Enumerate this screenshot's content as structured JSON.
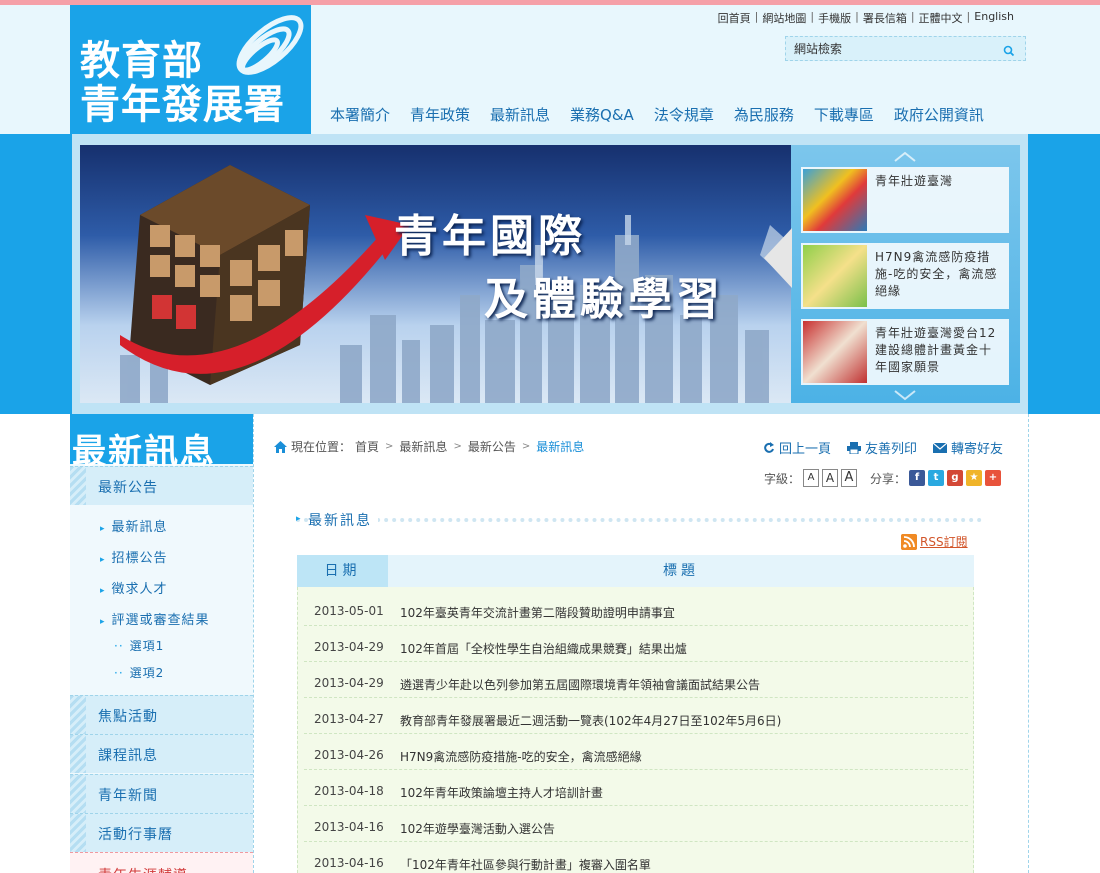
{
  "logo": {
    "line1": "教育部",
    "line2": "青年發展署"
  },
  "toplinks": [
    "回首頁",
    "網站地圖",
    "手機版",
    "署長信箱",
    "正體中文",
    "English"
  ],
  "search": {
    "placeholder": "網站檢索"
  },
  "nav": [
    "本署簡介",
    "青年政策",
    "最新訊息",
    "業務Q&A",
    "法令規章",
    "為民服務",
    "下載專區",
    "政府公開資訊"
  ],
  "banner": {
    "headline1": "青年國際",
    "headline2": "及體驗學習",
    "side_items": [
      "青年壯遊臺灣",
      "H7N9禽流感防疫措施-吃的安全，禽流感絕緣",
      "青年壯遊臺灣愛台12建設總體計畫黃金十年國家願景"
    ]
  },
  "sidebar": {
    "section_title": "最新訊息",
    "items": [
      {
        "label": "最新公告"
      },
      {
        "label": "最新訊息"
      },
      {
        "label": "招標公告"
      },
      {
        "label": "徵求人才"
      },
      {
        "label": "評選或審查結果"
      },
      {
        "label": "選項1"
      },
      {
        "label": "選項2"
      },
      {
        "label": "焦點活動"
      },
      {
        "label": "課程訊息"
      },
      {
        "label": "青年新聞"
      },
      {
        "label": "活動行事曆"
      },
      {
        "label": "青年生涯輔導"
      }
    ]
  },
  "breadcrumb": {
    "prefix": "現在位置：",
    "items": [
      "首頁",
      "最新訊息",
      "最新公告",
      "最新訊息"
    ]
  },
  "tools": {
    "back": "回上一頁",
    "print": "友善列印",
    "forward": "轉寄好友"
  },
  "fontsize": {
    "label": "字級：",
    "small": "A",
    "medium": "A",
    "large": "A"
  },
  "share": {
    "label": "分享："
  },
  "content": {
    "title": "最新訊息",
    "rss": "RSS訂閱",
    "col_date": "日期",
    "col_title": "標題",
    "rows": [
      {
        "date": "2013-05-01",
        "title": "102年臺英青年交流計畫第二階段贊助證明申請事宜"
      },
      {
        "date": "2013-04-29",
        "title": "102年首屆「全校性學生自治組織成果競賽」結果出爐"
      },
      {
        "date": "2013-04-29",
        "title": "遴選青少年赴以色列參加第五屆國際環境青年領袖會議面試結果公告"
      },
      {
        "date": "2013-04-27",
        "title": "教育部青年發展署最近二週活動一覽表(102年4月27日至102年5月6日)"
      },
      {
        "date": "2013-04-26",
        "title": "H7N9禽流感防疫措施-吃的安全，禽流感絕緣"
      },
      {
        "date": "2013-04-18",
        "title": "102年青年政策論壇主持人才培訓計畫"
      },
      {
        "date": "2013-04-16",
        "title": "102年遊學臺灣活動入選公告"
      },
      {
        "date": "2013-04-16",
        "title": "「102年青年社區參與行動計畫」複審入圍名單"
      }
    ]
  },
  "colors": {
    "brand_blue": "#1aa3e8",
    "link_blue": "#1a6fb0",
    "top_pink": "#f5a0a8"
  }
}
